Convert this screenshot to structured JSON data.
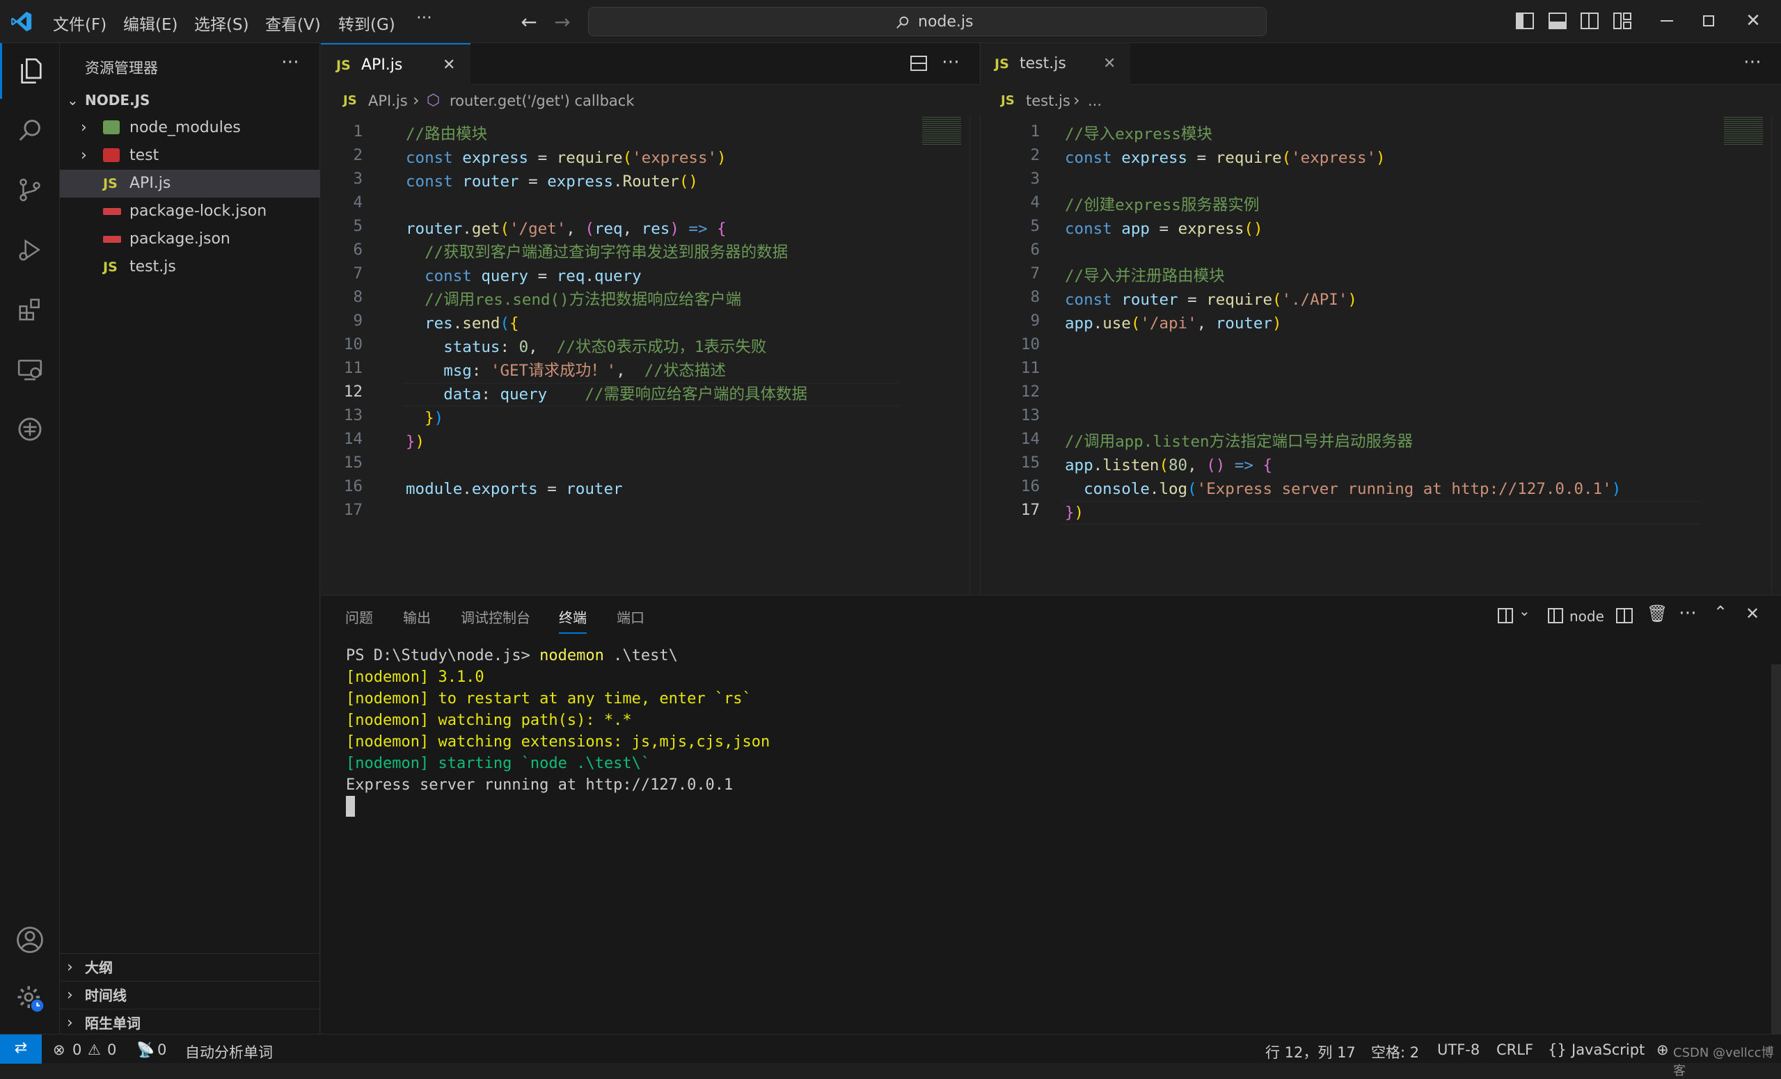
{
  "menu": [
    "文件(F)",
    "编辑(E)",
    "选择(S)",
    "查看(V)",
    "转到(G)",
    "⋯"
  ],
  "search": {
    "text": "node.js"
  },
  "sidebar": {
    "title": "资源管理器",
    "root": "NODE.JS",
    "items": [
      {
        "label": "node_modules",
        "type": "folder"
      },
      {
        "label": "test",
        "type": "folder"
      },
      {
        "label": "API.js",
        "type": "js"
      },
      {
        "label": "package-lock.json",
        "type": "json"
      },
      {
        "label": "package.json",
        "type": "json"
      },
      {
        "label": "test.js",
        "type": "js"
      }
    ],
    "sections": [
      "大纲",
      "时间线",
      "陌生单词"
    ]
  },
  "left_editor": {
    "tab": "API.js",
    "breadcrumb_file": "API.js",
    "breadcrumb_symbol": "router.get('/get') callback",
    "lines": [
      "//路由模块",
      "const express = require('express')",
      "const router = express.Router()",
      "",
      "router.get('/get', (req, res) => {",
      "  //获取到客户端通过查询字符串发送到服务器的数据",
      "  const query = req.query",
      "  //调用res.send()方法把数据响应给客户端",
      "  res.send({",
      "    status: 0,  //状态0表示成功，1表示失败",
      "    msg: 'GET请求成功！',  //状态描述",
      "    data: query    //需要响应给客户端的具体数据",
      "  })",
      "})",
      "",
      "module.exports = router",
      ""
    ],
    "current_line": 12
  },
  "right_editor": {
    "tab": "test.js",
    "breadcrumb_file": "test.js",
    "breadcrumb_symbol": "...",
    "lines": [
      "//导入express模块",
      "const express = require('express')",
      "",
      "//创建express服务器实例",
      "const app = express()",
      "",
      "//导入并注册路由模块",
      "const router = require('./API')",
      "app.use('/api', router)",
      "",
      "",
      "",
      "",
      "//调用app.listen方法指定端口号并启动服务器",
      "app.listen(80, () => {",
      "  console.log('Express server running at http://127.0.0.1')",
      "})"
    ],
    "current_line": 17
  },
  "panel": {
    "tabs": [
      "问题",
      "输出",
      "调试控制台",
      "终端",
      "端口"
    ],
    "active_tab": "终端",
    "terminal_name": "node",
    "terminal": {
      "prompt": "PS D:\\Study\\node.js> ",
      "command": "nodemon",
      "args": " .\\test\\",
      "out1": "[nodemon] 3.1.0",
      "out2": "[nodemon] to restart at any time, enter `rs`",
      "out3": "[nodemon] watching path(s): *.*",
      "out4": "[nodemon] watching extensions: js,mjs,cjs,json",
      "out5": "[nodemon] starting `node .\\test\\`",
      "out6": "Express server running at http://127.0.0.1"
    }
  },
  "status": {
    "errors": "0",
    "warnings": "0",
    "ports": "0",
    "spell": "自动分析单词",
    "position": "行 12，列 17",
    "spaces": "空格: 2",
    "encoding": "UTF-8",
    "eol": "CRLF",
    "language": "JavaScript",
    "watermark": "CSDN @vellcc博客"
  },
  "colors": {
    "accent": "#0078d4",
    "js": "#cbcb41",
    "json": "#cc3e44"
  }
}
